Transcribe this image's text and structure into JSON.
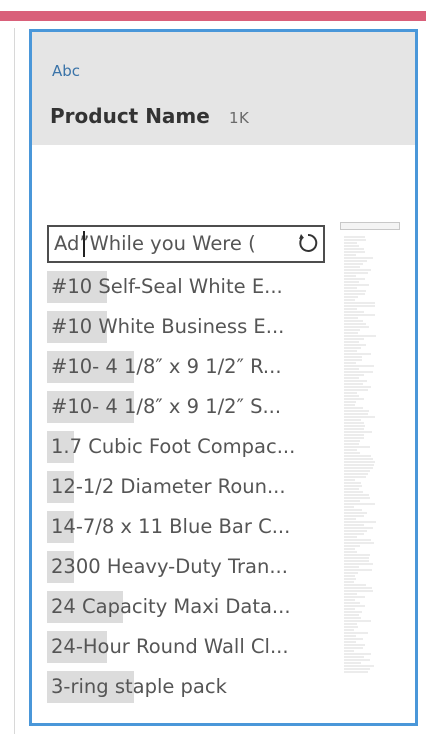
{
  "field": {
    "type_tag": "Abc",
    "name": "Product Name",
    "count": "1K"
  },
  "search": {
    "value": "Ad”While you Were ("
  },
  "values": [
    {
      "label": "#10 Self-Seal White E...",
      "fill": 0.22
    },
    {
      "label": "#10 White Business E...",
      "fill": 0.22
    },
    {
      "label": "#10- 4 1/8″ x 9 1/2″ R...",
      "fill": 0.32
    },
    {
      "label": "#10- 4 1/8″ x 9 1/2″ S...",
      "fill": 0.32
    },
    {
      "label": "1.7 Cubic Foot Compac...",
      "fill": 0.1
    },
    {
      "label": "12-1/2 Diameter Roun...",
      "fill": 0.1
    },
    {
      "label": "14-7/8 x 11 Blue Bar C...",
      "fill": 0.1
    },
    {
      "label": "2300 Heavy-Duty Tran...",
      "fill": 0.1
    },
    {
      "label": "24 Capacity Maxi Data...",
      "fill": 0.28
    },
    {
      "label": "24-Hour Round Wall Cl...",
      "fill": 0.22
    },
    {
      "label": "3-ring staple pack",
      "fill": 0.32
    }
  ],
  "colors": {
    "accent": "#4a97d9",
    "top_stripe": "#d9607a",
    "bar": "#dcdcdc",
    "header_bg": "#e5e5e5"
  },
  "icons": {
    "reset": "reset-icon"
  }
}
